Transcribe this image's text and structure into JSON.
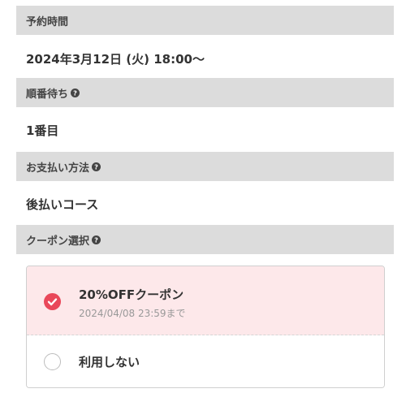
{
  "sections": {
    "reservation_time": {
      "label": "予約時間",
      "value": "2024年3月12日 (火) 18:00〜"
    },
    "queue": {
      "label": "順番待ち",
      "value": "1番目"
    },
    "payment": {
      "label": "お支払い方法",
      "value": "後払いコース"
    },
    "coupon": {
      "label": "クーポン選択"
    }
  },
  "coupon_options": [
    {
      "title": "20%OFFクーポン",
      "expiry": "2024/04/08 23:59まで",
      "selected": true
    },
    {
      "title": "利用しない",
      "selected": false
    }
  ],
  "icons": {
    "help": "question-circle-icon",
    "check": "check-icon"
  },
  "colors": {
    "header_bg": "#dcdcdc",
    "accent": "#e9485a",
    "selected_bg": "#fde8ea"
  }
}
